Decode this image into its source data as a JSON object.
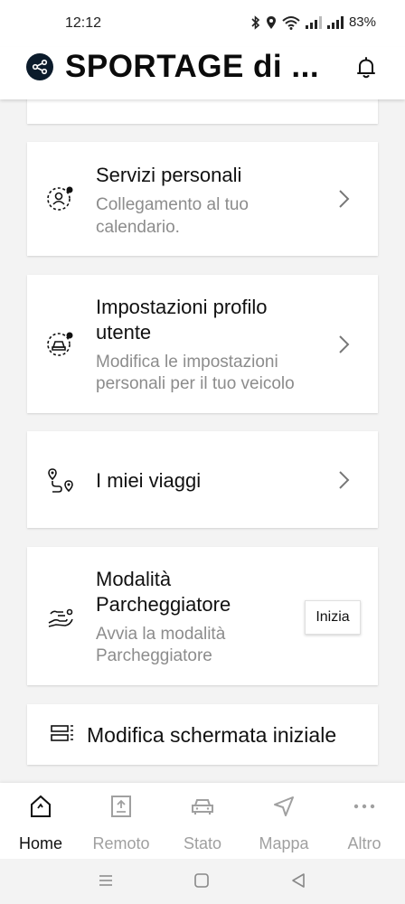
{
  "status_bar": {
    "time": "12:12",
    "battery": "83%"
  },
  "header": {
    "title": "SPORTAGE di ...",
    "share_icon": "share-icon",
    "bell_icon": "bell-icon"
  },
  "cards": {
    "personal_services": {
      "title": "Servizi personali",
      "subtitle_line1": "Collegamento al tuo",
      "subtitle_line2": "calendario."
    },
    "profile_settings": {
      "title_line1": "Impostazioni profilo",
      "title_line2": "utente",
      "subtitle_line1": "Modifica le impostazioni",
      "subtitle_line2": "personali per il tuo veicolo"
    },
    "my_trips": {
      "title": "I miei viaggi"
    },
    "valet_mode": {
      "title_line1": "Modalità",
      "title_line2": "Parcheggiatore",
      "subtitle_line1": "Avvia la modalità",
      "subtitle_line2": "Parcheggiatore",
      "button": "Inizia"
    },
    "edit_home": {
      "title": "Modifica schermata iniziale"
    }
  },
  "bottom_nav": {
    "items": [
      {
        "label": "Home",
        "active": true
      },
      {
        "label": "Remoto",
        "active": false
      },
      {
        "label": "Stato",
        "active": false
      },
      {
        "label": "Mappa",
        "active": false
      },
      {
        "label": "Altro",
        "active": false
      }
    ]
  },
  "colors": {
    "active": "#111111",
    "inactive": "#a0a0a0",
    "subtitle": "#8c8c8c",
    "background": "#f3f3f3"
  }
}
